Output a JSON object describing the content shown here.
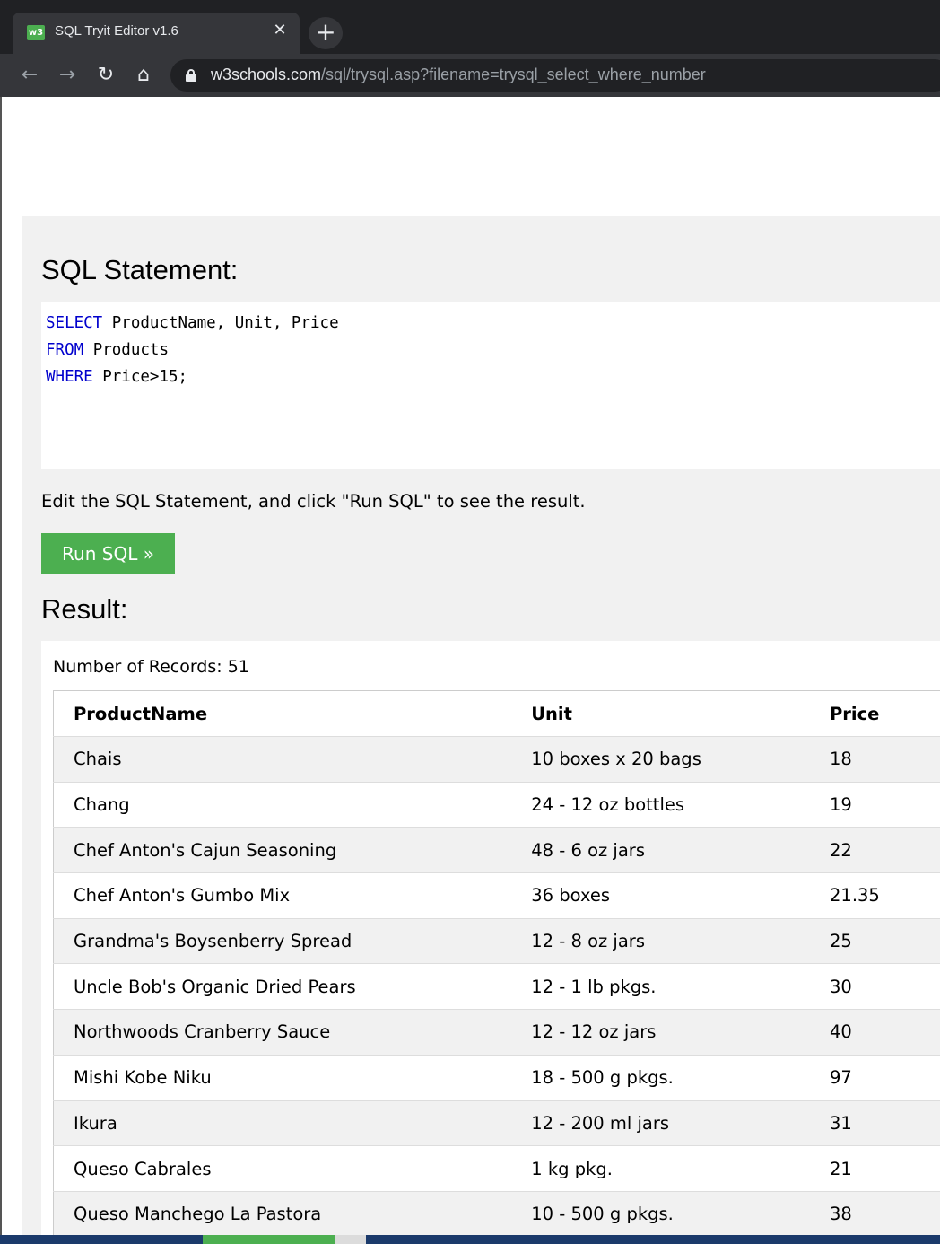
{
  "browser": {
    "tab_title": "SQL Tryit Editor v1.6",
    "tab_favicon_text": "w3",
    "close_glyph": "✕",
    "new_tab_glyph": "+",
    "back_glyph": "←",
    "forward_glyph": "→",
    "reload_glyph": "↻",
    "home_glyph": "⌂",
    "url_host": "w3schools.com",
    "url_path": "/sql/trysql.asp?filename=trysql_select_where_number"
  },
  "editor": {
    "heading": "SQL Statement:",
    "lines": [
      {
        "keyword": "SELECT",
        "rest": " ProductName, Unit, Price"
      },
      {
        "keyword": "FROM",
        "rest": " Products"
      },
      {
        "keyword": "WHERE",
        "rest": " Price>15;"
      }
    ],
    "hint": "Edit the SQL Statement, and click \"Run SQL\" to see the result.",
    "run_label": "Run SQL »"
  },
  "result": {
    "heading": "Result:",
    "records_label": "Number of Records: ",
    "records_count": "51",
    "columns": [
      "ProductName",
      "Unit",
      "Price"
    ],
    "rows": [
      [
        "Chais",
        "10 boxes x 20 bags",
        "18"
      ],
      [
        "Chang",
        "24 - 12 oz bottles",
        "19"
      ],
      [
        "Chef Anton's Cajun Seasoning",
        "48 - 6 oz jars",
        "22"
      ],
      [
        "Chef Anton's Gumbo Mix",
        "36 boxes",
        "21.35"
      ],
      [
        "Grandma's Boysenberry Spread",
        "12 - 8 oz jars",
        "25"
      ],
      [
        "Uncle Bob's Organic Dried Pears",
        "12 - 1 lb pkgs.",
        "30"
      ],
      [
        "Northwoods Cranberry Sauce",
        "12 - 12 oz jars",
        "40"
      ],
      [
        "Mishi Kobe Niku",
        "18 - 500 g pkgs.",
        "97"
      ],
      [
        "Ikura",
        "12 - 200 ml jars",
        "31"
      ],
      [
        "Queso Cabrales",
        "1 kg pkg.",
        "21"
      ],
      [
        "Queso Manchego La Pastora",
        "10 - 500 g pkgs.",
        "38"
      ]
    ]
  },
  "colors": {
    "accent_green": "#4caf50",
    "sql_keyword": "#0000cd",
    "panel_bg": "#f1f1f1"
  }
}
